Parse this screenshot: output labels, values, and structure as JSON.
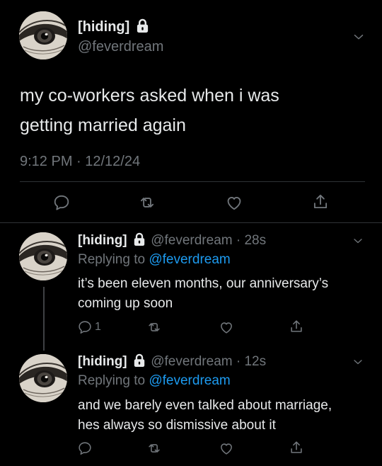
{
  "main_tweet": {
    "display_name": "[hiding]",
    "handle": "@feverdream",
    "text_line1": "my co-workers asked when i was",
    "text_line2": "getting married again",
    "timestamp": "9:12 PM · 12/12/24"
  },
  "replies": [
    {
      "display_name": "[hiding]",
      "handle": "@feverdream",
      "separator": "·",
      "age": "28s",
      "replying_prefix": "Replying to",
      "replying_handle": "@feverdream",
      "text_line1": "it’s been eleven months, our anniversary’s",
      "text_line2": "coming up soon",
      "reply_count": "1"
    },
    {
      "display_name": "[hiding]",
      "handle": "@feverdream",
      "separator": "·",
      "age": "12s",
      "replying_prefix": "Replying to",
      "replying_handle": "@feverdream",
      "text_line1": "and we barely even talked about marriage,",
      "text_line2": "hes always so dismissive about it",
      "reply_count": ""
    }
  ],
  "icons": {
    "reply": "reply-icon",
    "retweet": "retweet-icon",
    "like": "like-icon",
    "share": "share-icon",
    "more": "chevron-down-icon",
    "lock": "lock-icon"
  },
  "colors": {
    "background": "#000000",
    "text": "#e7e9ea",
    "muted": "#71767b",
    "link": "#1d9bf0",
    "divider": "#2f3336"
  }
}
